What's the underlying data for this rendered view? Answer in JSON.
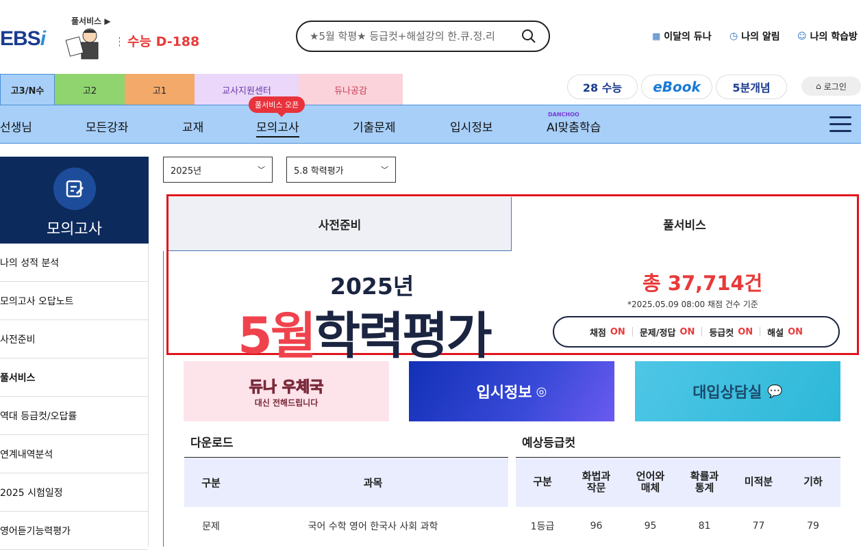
{
  "header": {
    "logo": "EBS",
    "logo_i": "i",
    "full_service_link": "풀서비스",
    "dday": "수능 D-188",
    "search_placeholder": "★5월 학평★ 등급컷+해설강의 한.큐.정.리",
    "util": [
      "이달의 듀나",
      "나의 알림",
      "나의 학습방"
    ]
  },
  "grade_tabs": [
    {
      "label": "고3/N수",
      "color": "#a7cff8"
    },
    {
      "label": "고2",
      "color": "#8fd46f"
    },
    {
      "label": "고1",
      "color": "#f2a96a"
    },
    {
      "label": "교사지원센터",
      "color": "#ead7f9"
    },
    {
      "label": "듀나공감",
      "color": "#fbd3da"
    }
  ],
  "quick_links": [
    "28 수능",
    "eBook",
    "5분개념"
  ],
  "login": "로그인",
  "gnb": {
    "items": [
      "선생님",
      "모든강좌",
      "교재",
      "모의고사",
      "기출문제",
      "입시정보",
      "AI맞춤학습"
    ],
    "ai_tag": "DANCHOO",
    "badge": "풀서비스 오픈"
  },
  "lnb": {
    "title": "모의고사",
    "items": [
      "나의 성적 분석",
      "모의고사 오답노트",
      "사전준비",
      "풀서비스",
      "역대 등급컷/오답률",
      "연계내역분석",
      "2025 시험일정",
      "영어듣기능력평가"
    ]
  },
  "filters": {
    "year": "2025년",
    "exam": "5.8 학력평가"
  },
  "content_tabs": [
    "사전준비",
    "풀서비스"
  ],
  "hero": {
    "year": "2025년",
    "month": "5월",
    "title": "학력평가",
    "total": "총 37,714건",
    "basis": "*2025.05.09 08:00 채점 건수 기준",
    "status": [
      {
        "label": "채점",
        "value": "ON"
      },
      {
        "label": "문제/정답",
        "value": "ON"
      },
      {
        "label": "등급컷",
        "value": "ON"
      },
      {
        "label": "해설",
        "value": "ON"
      }
    ]
  },
  "banners": [
    {
      "title": "듀나 우체국",
      "sub": "대신 전해드립니다"
    },
    {
      "title": "입시정보"
    },
    {
      "title": "대입상담실"
    }
  ],
  "download": {
    "title": "다운로드",
    "headers": [
      "구분",
      "과목"
    ],
    "rows": [
      [
        "문제",
        "국어 수학 영어 한국사 사회 과학"
      ]
    ]
  },
  "cutoff": {
    "title": "예상등급컷",
    "headers": [
      "구분",
      "화법과\n작문",
      "언어와\n매체",
      "확률과\n통계",
      "미적분",
      "기하"
    ],
    "rows": [
      [
        "1등급",
        "96",
        "95",
        "81",
        "77",
        "79"
      ]
    ]
  }
}
